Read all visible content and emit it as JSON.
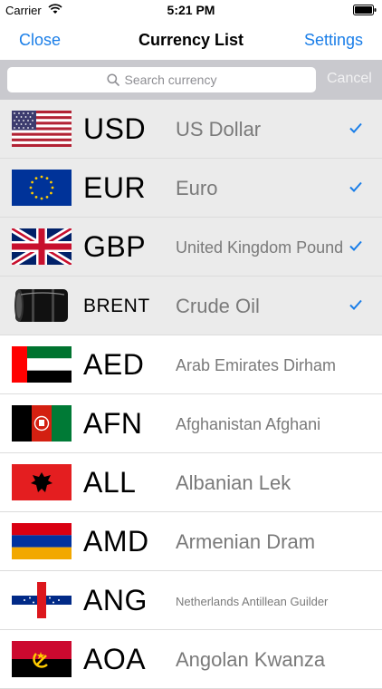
{
  "status": {
    "carrier": "Carrier",
    "time": "5:21 PM"
  },
  "nav": {
    "close": "Close",
    "title": "Currency List",
    "settings": "Settings"
  },
  "search": {
    "placeholder": "Search currency",
    "cancel": "Cancel"
  },
  "rows": [
    {
      "code": "USD",
      "name": "US Dollar",
      "selected": true,
      "flag": "us-flag"
    },
    {
      "code": "EUR",
      "name": "Euro",
      "selected": true,
      "flag": "eu-flag"
    },
    {
      "code": "GBP",
      "name": "United Kingdom Pound",
      "selected": true,
      "flag": "uk-flag"
    },
    {
      "code": "BRENT",
      "name": "Crude Oil",
      "selected": true,
      "flag": "oil-barrel"
    },
    {
      "code": "AED",
      "name": "Arab Emirates Dirham",
      "selected": false,
      "flag": "uae-flag"
    },
    {
      "code": "AFN",
      "name": "Afghanistan Afghani",
      "selected": false,
      "flag": "afghanistan-flag"
    },
    {
      "code": "ALL",
      "name": "Albanian Lek",
      "selected": false,
      "flag": "albania-flag"
    },
    {
      "code": "AMD",
      "name": "Armenian Dram",
      "selected": false,
      "flag": "armenia-flag"
    },
    {
      "code": "ANG",
      "name": "Netherlands Antillean Guilder",
      "selected": false,
      "flag": "netherlands-antilles-flag"
    },
    {
      "code": "AOA",
      "name": "Angolan Kwanza",
      "selected": false,
      "flag": "angola-flag"
    }
  ],
  "colors": {
    "accent": "#1a7ee8",
    "selected_row": "#ebebeb",
    "search_bar": "#c9c9ce"
  }
}
